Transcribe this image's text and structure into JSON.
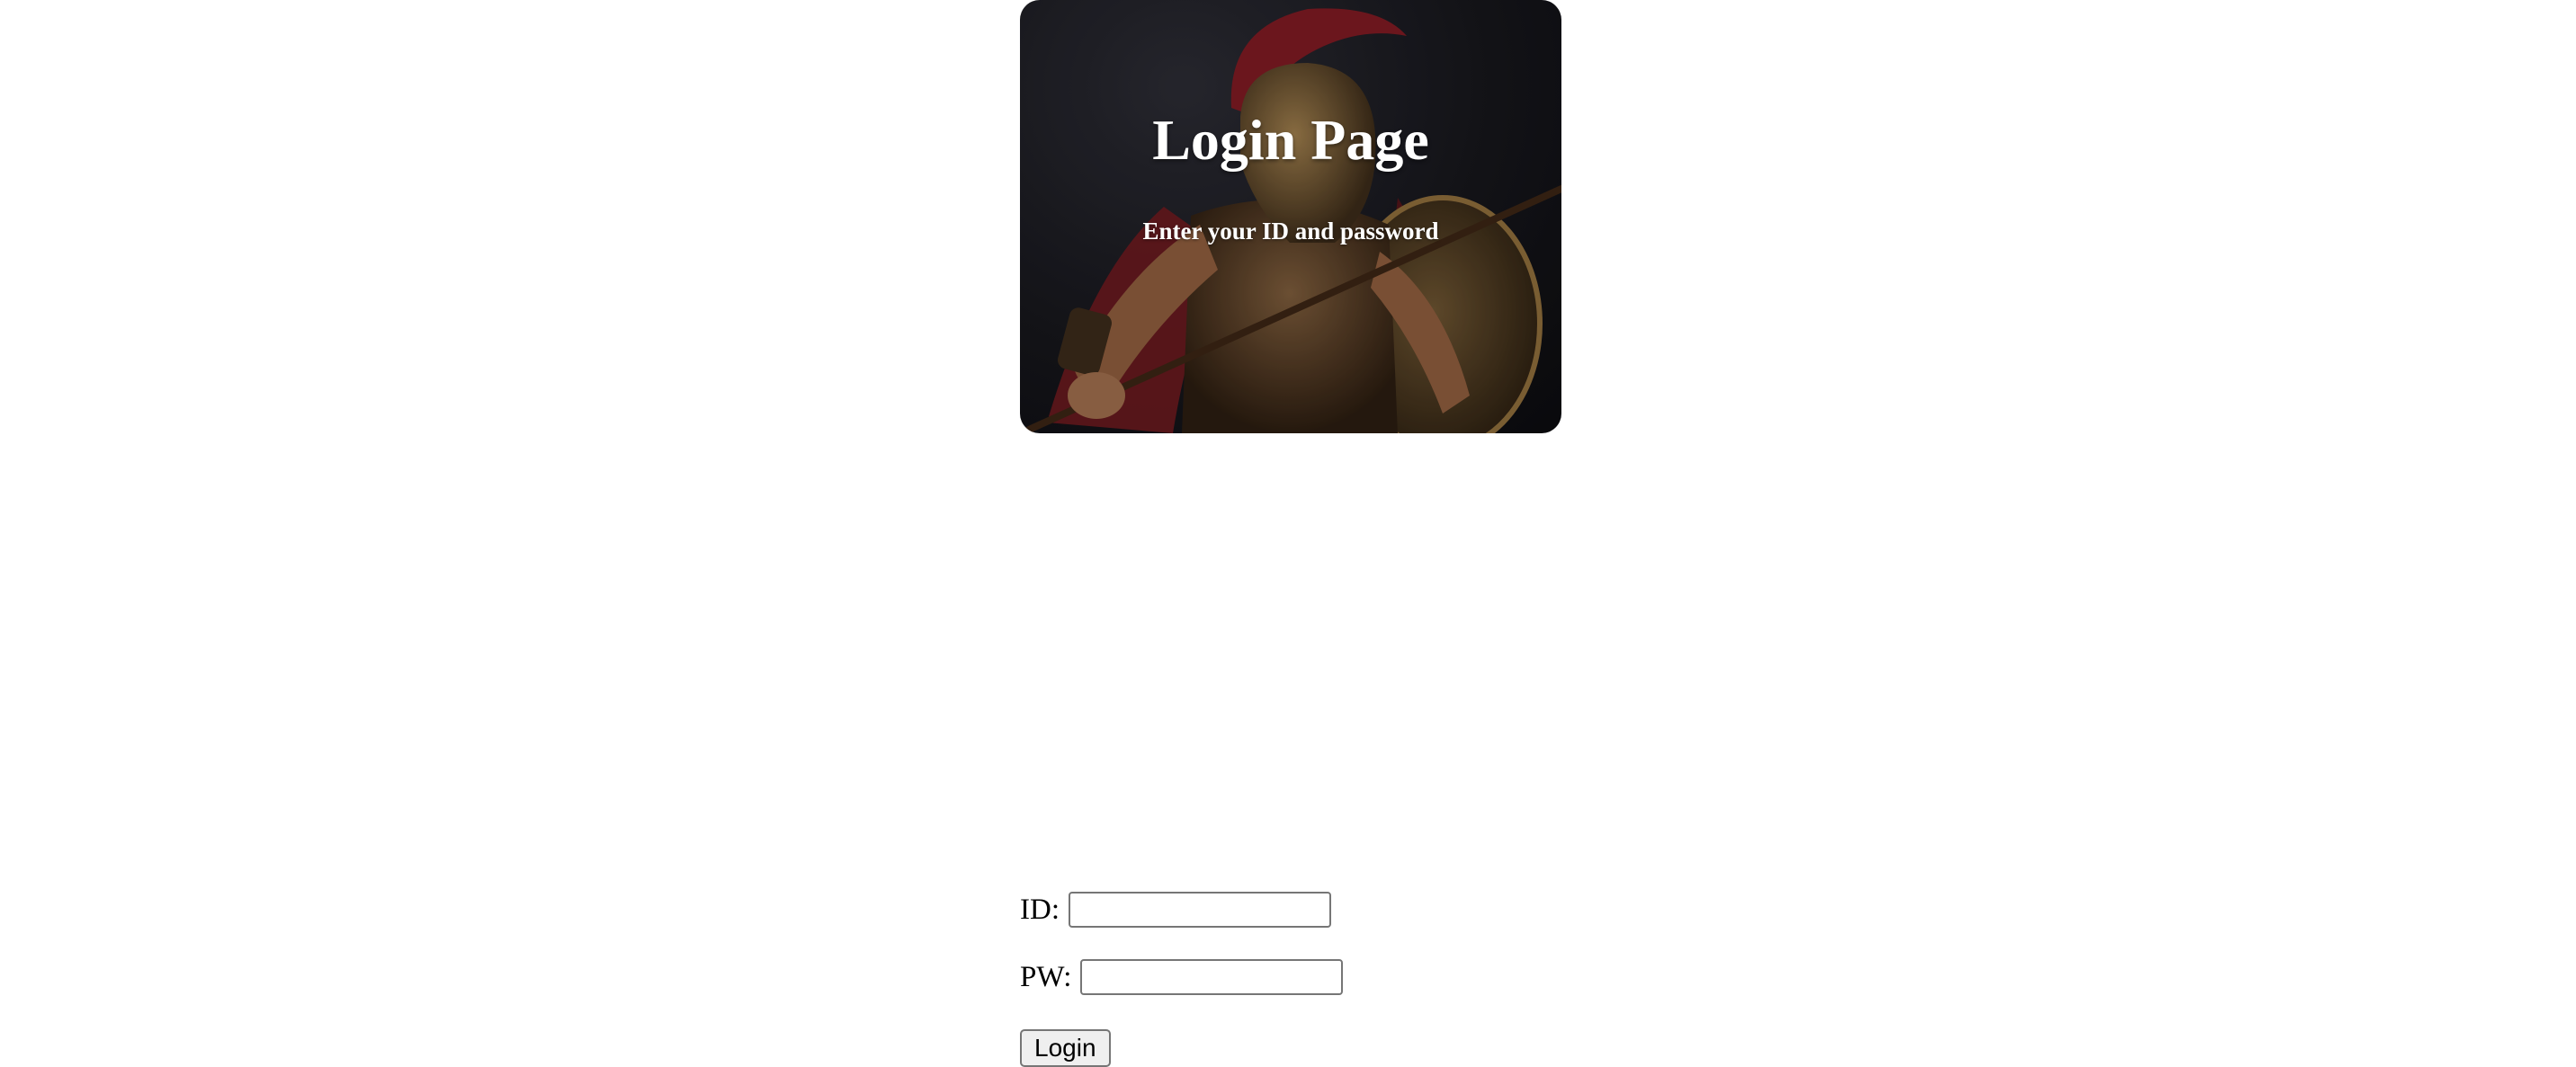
{
  "hero": {
    "title": "Login Page",
    "subtitle": "Enter your ID and password",
    "image": "spartan-warrior-figure"
  },
  "form": {
    "id_label": "ID:",
    "id_value": "",
    "id_placeholder": "",
    "pw_label": "PW:",
    "pw_value": "",
    "pw_placeholder": "",
    "submit_label": "Login"
  },
  "colors": {
    "hero_background": "#16161b",
    "hero_text": "#ffffff",
    "button_background": "#efefef",
    "input_border": "#767676"
  }
}
